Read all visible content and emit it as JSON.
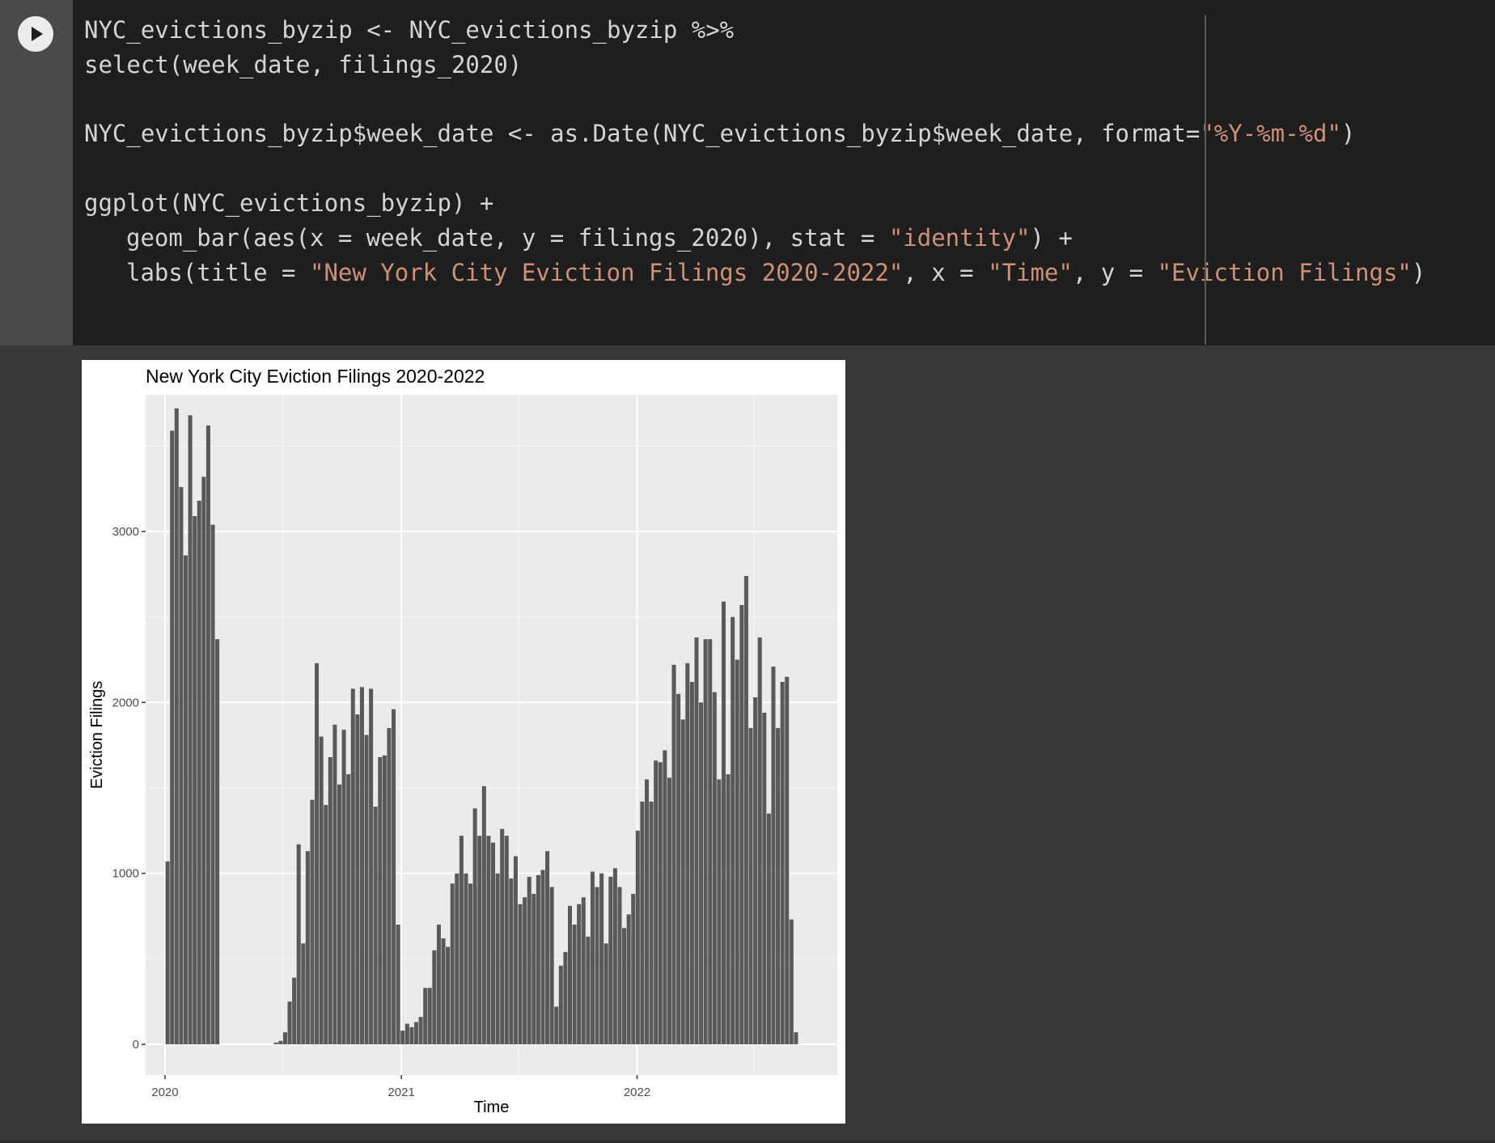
{
  "cell": {
    "run_button_icon": "play-icon",
    "code_lines": [
      {
        "parts": [
          {
            "t": "NYC_evictions_byzip <- NYC_evictions_byzip %>%"
          }
        ]
      },
      {
        "parts": [
          {
            "t": "select(week_date, filings_2020)"
          }
        ]
      },
      {
        "parts": []
      },
      {
        "parts": [
          {
            "t": "NYC_evictions_byzip$week_date <- as.Date(NYC_evictions_byzip$week_date, format="
          },
          {
            "t": "\"%Y-%m-%d\"",
            "s": true
          },
          {
            "t": ")"
          }
        ]
      },
      {
        "parts": []
      },
      {
        "parts": [
          {
            "t": "ggplot(NYC_evictions_byzip) +"
          }
        ]
      },
      {
        "indent": true,
        "parts": [
          {
            "t": "geom_bar(aes(x = week_date, y = filings_2020), stat = "
          },
          {
            "t": "\"identity\"",
            "s": true
          },
          {
            "t": ") +"
          }
        ]
      },
      {
        "indent": true,
        "parts": [
          {
            "t": "labs(title = "
          },
          {
            "t": "\"New York City Eviction Filings 2020-2022\"",
            "s": true
          },
          {
            "t": ", x = "
          },
          {
            "t": "\"Time\"",
            "s": true
          },
          {
            "t": ", y = "
          },
          {
            "t": "\"Eviction Filings\"",
            "s": true
          },
          {
            "t": ")"
          }
        ]
      }
    ]
  },
  "chart_data": {
    "type": "bar",
    "title": "New York City Eviction Filings 2020-2022",
    "xlabel": "Time",
    "ylabel": "Eviction Filings",
    "x_ticks": [
      "2020",
      "2021",
      "2022"
    ],
    "y_ticks": [
      0,
      1000,
      2000,
      3000
    ],
    "ylim": [
      -180,
      3800
    ],
    "xlim": [
      "2019-12-02",
      "2022-11-07"
    ],
    "grid": true,
    "bar_color": "#595959",
    "panel_bg": "#ebebeb",
    "week_dates": [
      "2020-01-05",
      "2020-01-12",
      "2020-01-19",
      "2020-01-26",
      "2020-02-02",
      "2020-02-09",
      "2020-02-16",
      "2020-02-23",
      "2020-03-01",
      "2020-03-08",
      "2020-03-15",
      "2020-03-22",
      "2020-03-29",
      "2020-04-05",
      "2020-04-12",
      "2020-04-19",
      "2020-04-26",
      "2020-05-03",
      "2020-05-10",
      "2020-05-17",
      "2020-05-24",
      "2020-05-31",
      "2020-06-07",
      "2020-06-14",
      "2020-06-21",
      "2020-06-28",
      "2020-07-05",
      "2020-07-12",
      "2020-07-19",
      "2020-07-26",
      "2020-08-02",
      "2020-08-09",
      "2020-08-16",
      "2020-08-23",
      "2020-08-30",
      "2020-09-06",
      "2020-09-13",
      "2020-09-20",
      "2020-09-27",
      "2020-10-04",
      "2020-10-11",
      "2020-10-18",
      "2020-10-25",
      "2020-11-01",
      "2020-11-08",
      "2020-11-15",
      "2020-11-22",
      "2020-11-29",
      "2020-12-06",
      "2020-12-13",
      "2020-12-20",
      "2020-12-27",
      "2021-01-03",
      "2021-01-10",
      "2021-01-17",
      "2021-01-24",
      "2021-01-31",
      "2021-02-07",
      "2021-02-14",
      "2021-02-21",
      "2021-02-28",
      "2021-03-07",
      "2021-03-14",
      "2021-03-21",
      "2021-03-28",
      "2021-04-04",
      "2021-04-11",
      "2021-04-18",
      "2021-04-25",
      "2021-05-02",
      "2021-05-09",
      "2021-05-16",
      "2021-05-23",
      "2021-05-30",
      "2021-06-06",
      "2021-06-13",
      "2021-06-20",
      "2021-06-27",
      "2021-07-04",
      "2021-07-11",
      "2021-07-18",
      "2021-07-25",
      "2021-08-01",
      "2021-08-08",
      "2021-08-15",
      "2021-08-22",
      "2021-08-29",
      "2021-09-05",
      "2021-09-12",
      "2021-09-19",
      "2021-09-26",
      "2021-10-03",
      "2021-10-10",
      "2021-10-17",
      "2021-10-24",
      "2021-10-31",
      "2021-11-07",
      "2021-11-14",
      "2021-11-21",
      "2021-11-28",
      "2021-12-05",
      "2021-12-12",
      "2021-12-19",
      "2021-12-26",
      "2022-01-02",
      "2022-01-09",
      "2022-01-16",
      "2022-01-23",
      "2022-01-30",
      "2022-02-06",
      "2022-02-13",
      "2022-02-20",
      "2022-02-27",
      "2022-03-06",
      "2022-03-13",
      "2022-03-20",
      "2022-03-27",
      "2022-04-03",
      "2022-04-10",
      "2022-04-17",
      "2022-04-24",
      "2022-05-01",
      "2022-05-08",
      "2022-05-15",
      "2022-05-22",
      "2022-05-29",
      "2022-06-05",
      "2022-06-12",
      "2022-06-19",
      "2022-06-26",
      "2022-07-03",
      "2022-07-10",
      "2022-07-17",
      "2022-07-24",
      "2022-07-31",
      "2022-08-07",
      "2022-08-14",
      "2022-08-21",
      "2022-08-28",
      "2022-09-04",
      "2022-09-11",
      "2022-09-18",
      "2022-09-25",
      "2022-10-02",
      "2022-10-09",
      "2022-10-16"
    ],
    "values": [
      1070,
      3590,
      3720,
      3260,
      2860,
      3680,
      3090,
      3180,
      3320,
      3620,
      3040,
      2370,
      0,
      0,
      0,
      0,
      0,
      0,
      0,
      0,
      0,
      0,
      0,
      0,
      10,
      20,
      70,
      250,
      390,
      1170,
      590,
      1130,
      1430,
      2230,
      1800,
      1400,
      1680,
      1870,
      1520,
      1840,
      1580,
      2080,
      1930,
      2090,
      1810,
      2080,
      1390,
      1680,
      1690,
      1850,
      1960,
      700,
      80,
      120,
      100,
      130,
      160,
      330,
      330,
      550,
      700,
      620,
      570,
      940,
      1000,
      1220,
      1000,
      940,
      1380,
      1220,
      1510,
      1220,
      1180,
      1000,
      1260,
      1220,
      970,
      1100,
      820,
      860,
      980,
      880,
      990,
      1020,
      1130,
      920,
      220,
      460,
      540,
      810,
      700,
      820,
      860,
      630,
      1010,
      920,
      1000,
      590,
      980,
      1030,
      920,
      680,
      760,
      880,
      1250,
      1420,
      1550,
      1420,
      1660,
      1650,
      1720,
      1560,
      2220,
      2050,
      1900,
      2230,
      2120,
      2380,
      2000,
      2370,
      2370,
      2060,
      1550,
      2590,
      1580,
      2500,
      2250,
      2570,
      2740,
      1850,
      2030,
      2380,
      1940,
      1350,
      2210,
      1850,
      2120,
      2150,
      730,
      70
    ]
  }
}
